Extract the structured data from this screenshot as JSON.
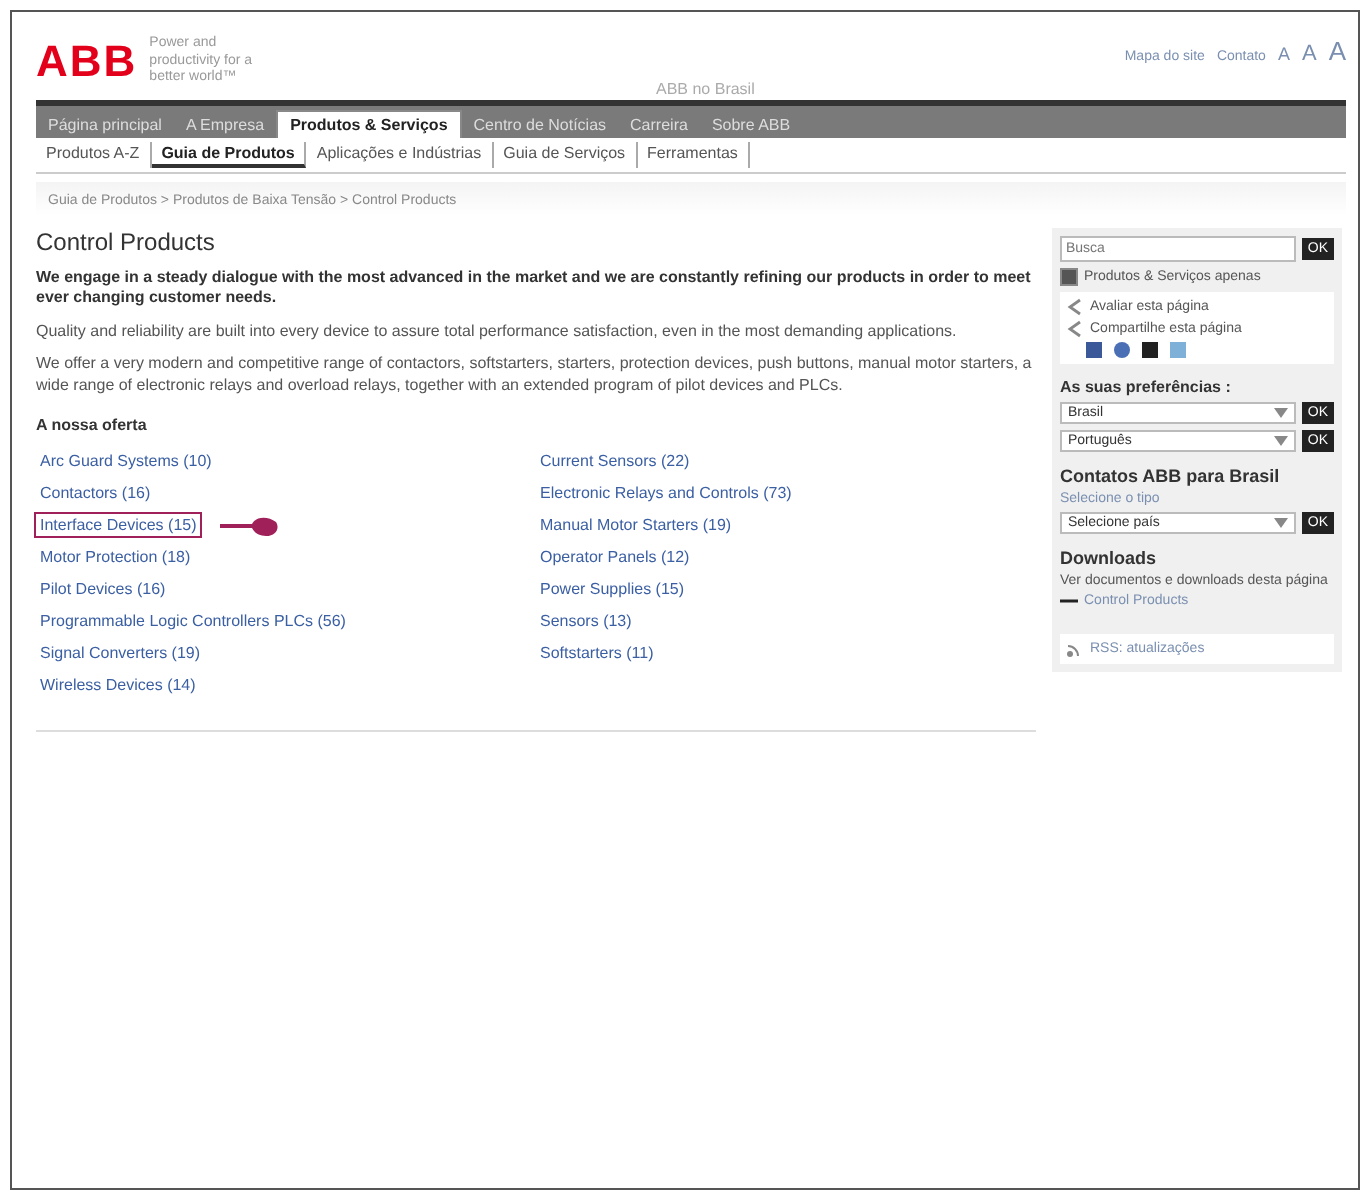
{
  "header": {
    "logo": "ABB",
    "tagline": "Power and productivity for a better world™",
    "site": "ABB no Brasil",
    "top_links": [
      "Mapa do site",
      "Contato"
    ],
    "font_sizes": [
      "A",
      "A",
      "A"
    ]
  },
  "nav": [
    {
      "label": "Página principal",
      "selected": false
    },
    {
      "label": "A Empresa",
      "selected": false
    },
    {
      "label": "Produtos & Serviços",
      "selected": true
    },
    {
      "label": "Centro de Notícias",
      "selected": false
    },
    {
      "label": "Carreira",
      "selected": false
    },
    {
      "label": "Sobre ABB",
      "selected": false
    }
  ],
  "subnav": [
    {
      "label": "Produtos A-Z",
      "selected": false
    },
    {
      "label": "Guia de Produtos",
      "selected": true
    },
    {
      "label": "Aplicações e Indústrias",
      "selected": false
    },
    {
      "label": "Guia de Serviços",
      "selected": false
    },
    {
      "label": "Ferramentas",
      "selected": false
    }
  ],
  "breadcrumb": "Guia de Produtos > Produtos de Baixa Tensão > Control Products",
  "title": "Control Products",
  "intro": "We engage in a steady dialogue with the most advanced in the market and we are constantly refining our products in order to meet ever changing customer needs.",
  "paragraphs": [
    "Quality and reliability are built into every device to assure total performance satisfaction, even in the most demanding applications.",
    "We offer a very modern and competitive range of contactors, softstarters, starters, protection devices, push buttons, manual motor starters, a wide range of electronic relays and overload relays, together with an extended program of pilot devices and PLCs."
  ],
  "offer": {
    "heading": "A nossa oferta",
    "columns": [
      [
        {
          "label": "Arc Guard Systems (10)",
          "highlighted": false
        },
        {
          "label": "Contactors (16)",
          "highlighted": false
        },
        {
          "label": "Interface Devices (15)",
          "highlighted": true
        },
        {
          "label": "Motor Protection (18)",
          "highlighted": false
        },
        {
          "label": "Pilot Devices (16)",
          "highlighted": false
        },
        {
          "label": "Programmable Logic Controllers PLCs (56)",
          "highlighted": false
        },
        {
          "label": "Signal Converters (19)",
          "highlighted": false
        },
        {
          "label": "Wireless Devices (14)",
          "highlighted": false
        }
      ],
      [
        {
          "label": "Current Sensors (22)",
          "highlighted": false
        },
        {
          "label": "Electronic Relays and Controls (73)",
          "highlighted": false
        },
        {
          "label": "Manual Motor Starters (19)",
          "highlighted": false
        },
        {
          "label": "Operator Panels (12)",
          "highlighted": false
        },
        {
          "label": "Power Supplies (15)",
          "highlighted": false
        },
        {
          "label": "Sensors (13)",
          "highlighted": false
        },
        {
          "label": "Softstarters (11)",
          "highlighted": false
        }
      ]
    ]
  },
  "sidebar": {
    "search": {
      "placeholder": "Busca",
      "button": "OK"
    },
    "filter": {
      "label": "Produtos & Serviços apenas",
      "checked": true
    },
    "page_links": [
      "Avaliar esta página",
      "Compartilhe esta página"
    ],
    "preferences": {
      "heading": "As suas preferências :",
      "selects": [
        {
          "value": "Brasil",
          "button": "OK"
        },
        {
          "value": "Português",
          "button": "OK"
        }
      ]
    },
    "contacts": {
      "heading": "Contatos ABB para Brasil",
      "link": "Selecione o tipo",
      "select": "Selecione país",
      "button": "OK"
    },
    "downloads": {
      "heading": "Downloads",
      "text": "Ver documentos e downloads desta página",
      "link": "Control Products"
    },
    "rss": "RSS: atualizações"
  }
}
